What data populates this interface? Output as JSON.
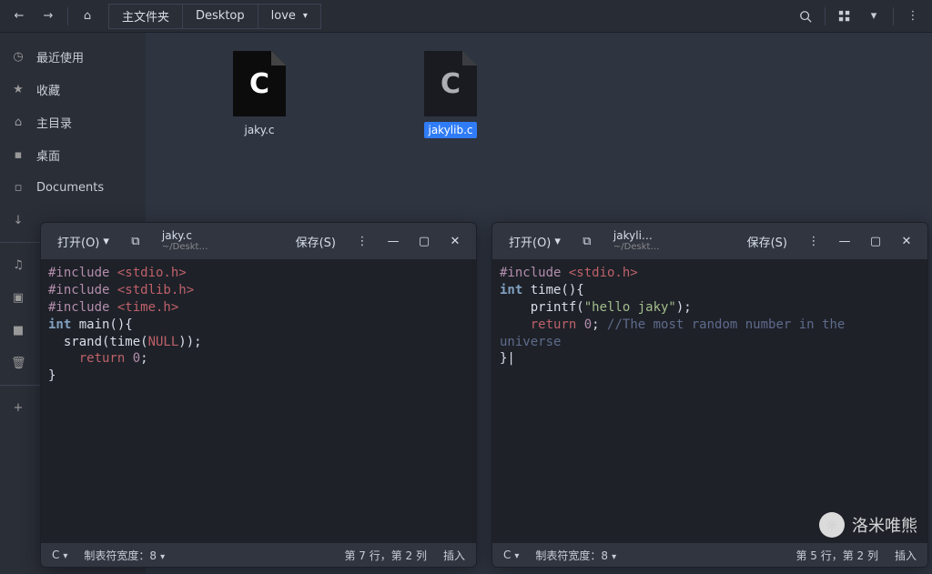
{
  "toolbar": {
    "back": "←",
    "forward": "→",
    "home": "⌂"
  },
  "breadcrumbs": [
    "主文件夹",
    "Desktop",
    "love"
  ],
  "sidebar": {
    "items": [
      {
        "icon": "◷",
        "label": "最近使用"
      },
      {
        "icon": "★",
        "label": "收藏"
      },
      {
        "icon": "⌂",
        "label": "主目录"
      },
      {
        "icon": "▪",
        "label": "桌面"
      },
      {
        "icon": "▫",
        "label": "Documents"
      },
      {
        "icon": "↓",
        "label": ""
      }
    ],
    "lower": [
      {
        "icon": "♫",
        "label": ""
      },
      {
        "icon": "▣",
        "label": ""
      },
      {
        "icon": "■",
        "label": ""
      },
      {
        "icon": "🗑",
        "label": ""
      }
    ],
    "add": "+"
  },
  "files": [
    {
      "badge": "C",
      "name": "jaky.c",
      "selected": false
    },
    {
      "badge": "C",
      "name": "jakylib.c",
      "selected": true
    }
  ],
  "editors": {
    "left": {
      "open_label": "打开(O)",
      "save_label": "保存(S)",
      "filename": "jaky.c",
      "filepath": "~/Deskt…",
      "code_lines": [
        [
          {
            "cls": "tok-pp",
            "t": "#include "
          },
          {
            "cls": "tok-inc",
            "t": "<stdio.h>"
          }
        ],
        [
          {
            "cls": "tok-pp",
            "t": "#include "
          },
          {
            "cls": "tok-inc",
            "t": "<stdlib.h>"
          }
        ],
        [
          {
            "cls": "tok-pp",
            "t": "#include "
          },
          {
            "cls": "tok-inc",
            "t": "<time.h>"
          }
        ],
        [
          {
            "cls": "tok-kw",
            "t": "int "
          },
          {
            "cls": "tok-fn",
            "t": "main(){"
          }
        ],
        [
          {
            "cls": "",
            "t": "  srand(time("
          },
          {
            "cls": "tok-null",
            "t": "NULL"
          },
          {
            "cls": "",
            "t": "));"
          }
        ],
        [
          {
            "cls": "",
            "t": "    "
          },
          {
            "cls": "tok-retkw",
            "t": "return "
          },
          {
            "cls": "tok-num",
            "t": "0"
          },
          {
            "cls": "",
            "t": ";"
          }
        ],
        [
          {
            "cls": "",
            "t": "}"
          }
        ]
      ],
      "status": {
        "lang": "C",
        "tab": "制表符宽度：8",
        "pos": "第 7 行，第 2 列",
        "mode": "插入"
      }
    },
    "right": {
      "open_label": "打开(O)",
      "save_label": "保存(S)",
      "filename": "jakyli…",
      "filepath": "~/Deskt…",
      "code_lines": [
        [
          {
            "cls": "tok-pp",
            "t": "#include "
          },
          {
            "cls": "tok-inc",
            "t": "<stdio.h>"
          }
        ],
        [
          {
            "cls": "tok-kw",
            "t": "int "
          },
          {
            "cls": "tok-fn",
            "t": "time(){"
          }
        ],
        [
          {
            "cls": "",
            "t": "    printf("
          },
          {
            "cls": "tok-str",
            "t": "\"hello jaky\""
          },
          {
            "cls": "",
            "t": ");"
          }
        ],
        [
          {
            "cls": "",
            "t": "    "
          },
          {
            "cls": "tok-retkw",
            "t": "return "
          },
          {
            "cls": "tok-num",
            "t": "0"
          },
          {
            "cls": "",
            "t": "; "
          },
          {
            "cls": "tok-cmt",
            "t": "//The most random number in the"
          }
        ],
        [
          {
            "cls": "tok-cmt",
            "t": "universe"
          }
        ],
        [
          {
            "cls": "",
            "t": "}|"
          }
        ]
      ],
      "status": {
        "lang": "C",
        "tab": "制表符宽度：8",
        "pos": "第 5 行，第 2 列",
        "mode": "插入"
      }
    }
  },
  "watermark": {
    "text": "洛米唯熊"
  }
}
